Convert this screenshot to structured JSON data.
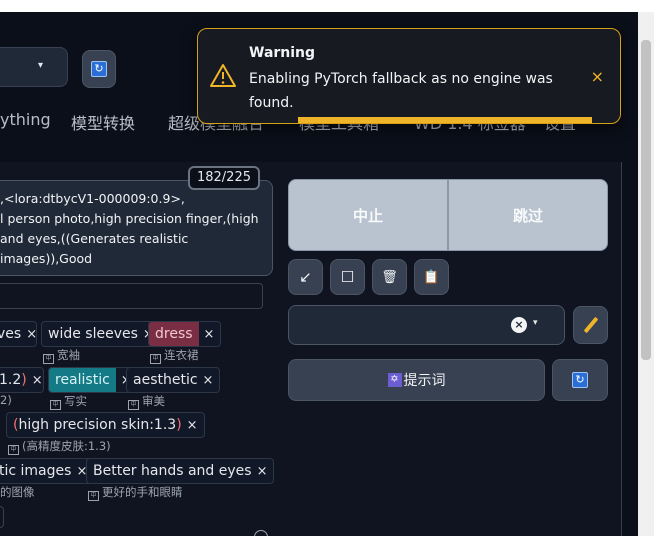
{
  "tabs": [
    "ything",
    "模型转换",
    "超级模型融合",
    "模型工具箱",
    "WD 1.4 标签器",
    "设置"
  ],
  "toast": {
    "title": "Warning",
    "message": "Enabling PyTorch fallback as no engine was found.",
    "close": "×"
  },
  "model_select": {
    "caret": "▾"
  },
  "token_counter": "182/225",
  "prompt": {
    "line1": ",<lora:dtbycV1-000009:0.9>,",
    "line2": "l person photo,high precision finger,(high",
    "line3": "and eyes,((Generates realistic images)),Good"
  },
  "tags": {
    "r1": [
      {
        "label": "ves",
        "trans": ""
      },
      {
        "label": "wide sleeves",
        "trans": "宽袖"
      },
      {
        "label": "dress",
        "trans": "连衣裙"
      }
    ],
    "r2": [
      {
        "label": "1.2",
        "trans": "2)"
      },
      {
        "label": "realistic",
        "trans": "写实"
      },
      {
        "label": "aesthetic",
        "trans": "审美"
      }
    ],
    "r3": [
      {
        "label": "high precision skin:1.3",
        "trans": "(高精度皮肤:1.3)"
      }
    ],
    "r4": [
      {
        "label": "tic images",
        "trans": "的图像"
      },
      {
        "label": "Better hands and eyes",
        "trans": "更好的手和眼睛"
      }
    ],
    "close": "×",
    "trans_badge": "中"
  },
  "buttons": {
    "interrupt": "中止",
    "skip": "跳过",
    "hint": "提示词",
    "refresh_glyph": "↻",
    "clear_glyph": "×",
    "caret": "▾",
    "arrow_glyph": "↙",
    "square_glyph": "☐",
    "trash_glyph": "🗑",
    "clipboard_glyph": "📋",
    "star_glyph": "✡"
  }
}
